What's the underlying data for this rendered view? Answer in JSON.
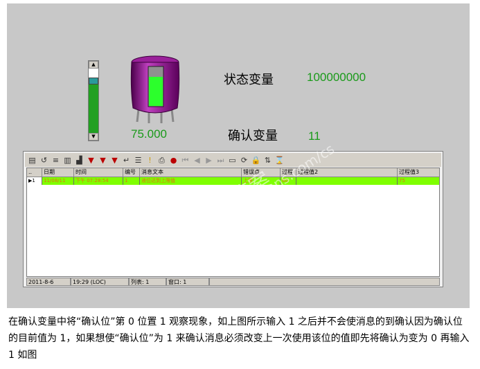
{
  "tank": {
    "value": "75.000",
    "fill_fraction": 0.75
  },
  "slider": {
    "fill_fraction": 0.75
  },
  "labels": {
    "status_var": "状态变量",
    "status_value": "100000000",
    "ack_var": "确认变量",
    "ack_value": "11"
  },
  "alarm": {
    "columns": [
      "..",
      "日期",
      "时间",
      "编号",
      "消息文本",
      "错误点",
      "过程",
      "过程值2",
      "过程值3"
    ],
    "row": {
      "marker": "▶1",
      "date": "11/08/11",
      "time": "下午 07:28:54",
      "number": "1",
      "text": "液位达到上限值",
      "error_point": "上限",
      "process": "80",
      "value2": "",
      "value3": "75"
    },
    "status": {
      "date": "2011-8-6",
      "time": "19:29 (LOC)",
      "list": "列表: 1",
      "window": "窗口: 1"
    }
  },
  "watermark": {
    "line1": "西门子工业 答案",
    "line2": "support.industry.siemens.com/cs"
  },
  "caption": "在确认变量中将“确认位”第 0 位置 1 观察现象，如上图所示输入 1 之后并不会使消息的到确认因为确认位的目前值为 1，如果想使“确认位”为 1 来确认消息必须改变上一次使用该位的值即先将确认为变为 0 再输入 1 如图",
  "colors": {
    "accent_green": "#1a9a1a",
    "tank_purple": "#8a1a8a",
    "row_green": "#7fff00"
  }
}
